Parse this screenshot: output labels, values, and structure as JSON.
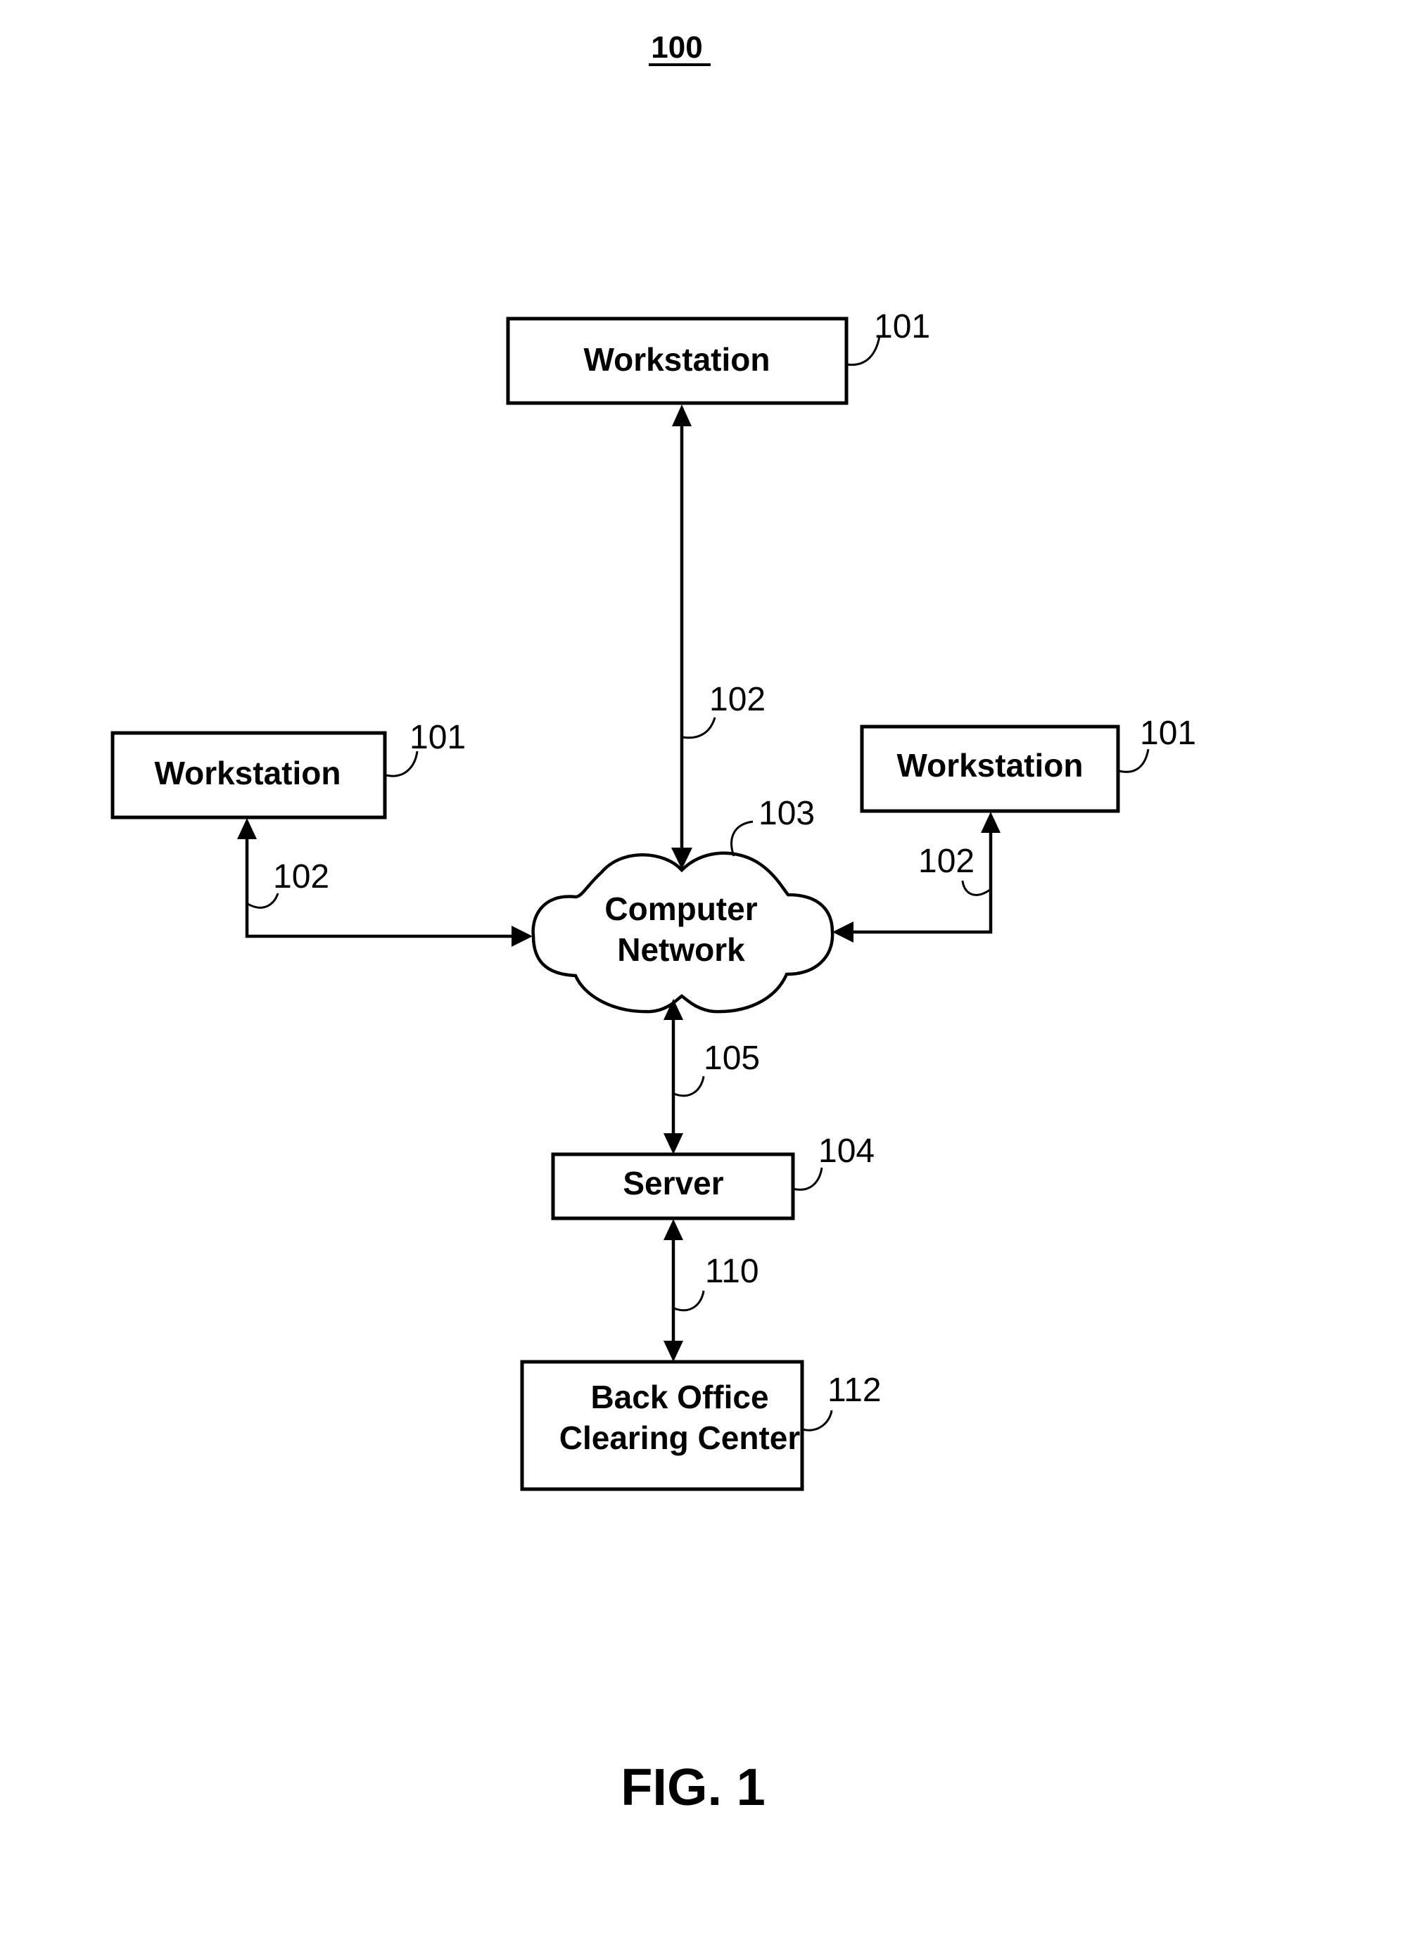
{
  "figure": {
    "number_label": "100",
    "caption": "FIG. 1"
  },
  "nodes": {
    "workstation_top": {
      "label": "Workstation",
      "ref": "101"
    },
    "workstation_left": {
      "label": "Workstation",
      "ref": "101"
    },
    "workstation_right": {
      "label": "Workstation",
      "ref": "101"
    },
    "network": {
      "label_line1": "Computer",
      "label_line2": "Network",
      "ref": "103"
    },
    "server": {
      "label": "Server",
      "ref": "104"
    },
    "back_office": {
      "label_line1": "Back Office",
      "label_line2": "Clearing Center",
      "ref": "112"
    }
  },
  "connections": {
    "top_link": {
      "ref": "102",
      "from": "workstation_top",
      "to": "network",
      "bidirectional": true
    },
    "left_link": {
      "ref": "102",
      "from": "workstation_left",
      "to": "network",
      "bidirectional": true
    },
    "right_link": {
      "ref": "102",
      "from": "workstation_right",
      "to": "network",
      "bidirectional": true
    },
    "network_server_link": {
      "ref": "105",
      "from": "network",
      "to": "server",
      "bidirectional": true
    },
    "server_backoffice_link": {
      "ref": "110",
      "from": "server",
      "to": "back_office",
      "bidirectional": true
    }
  }
}
